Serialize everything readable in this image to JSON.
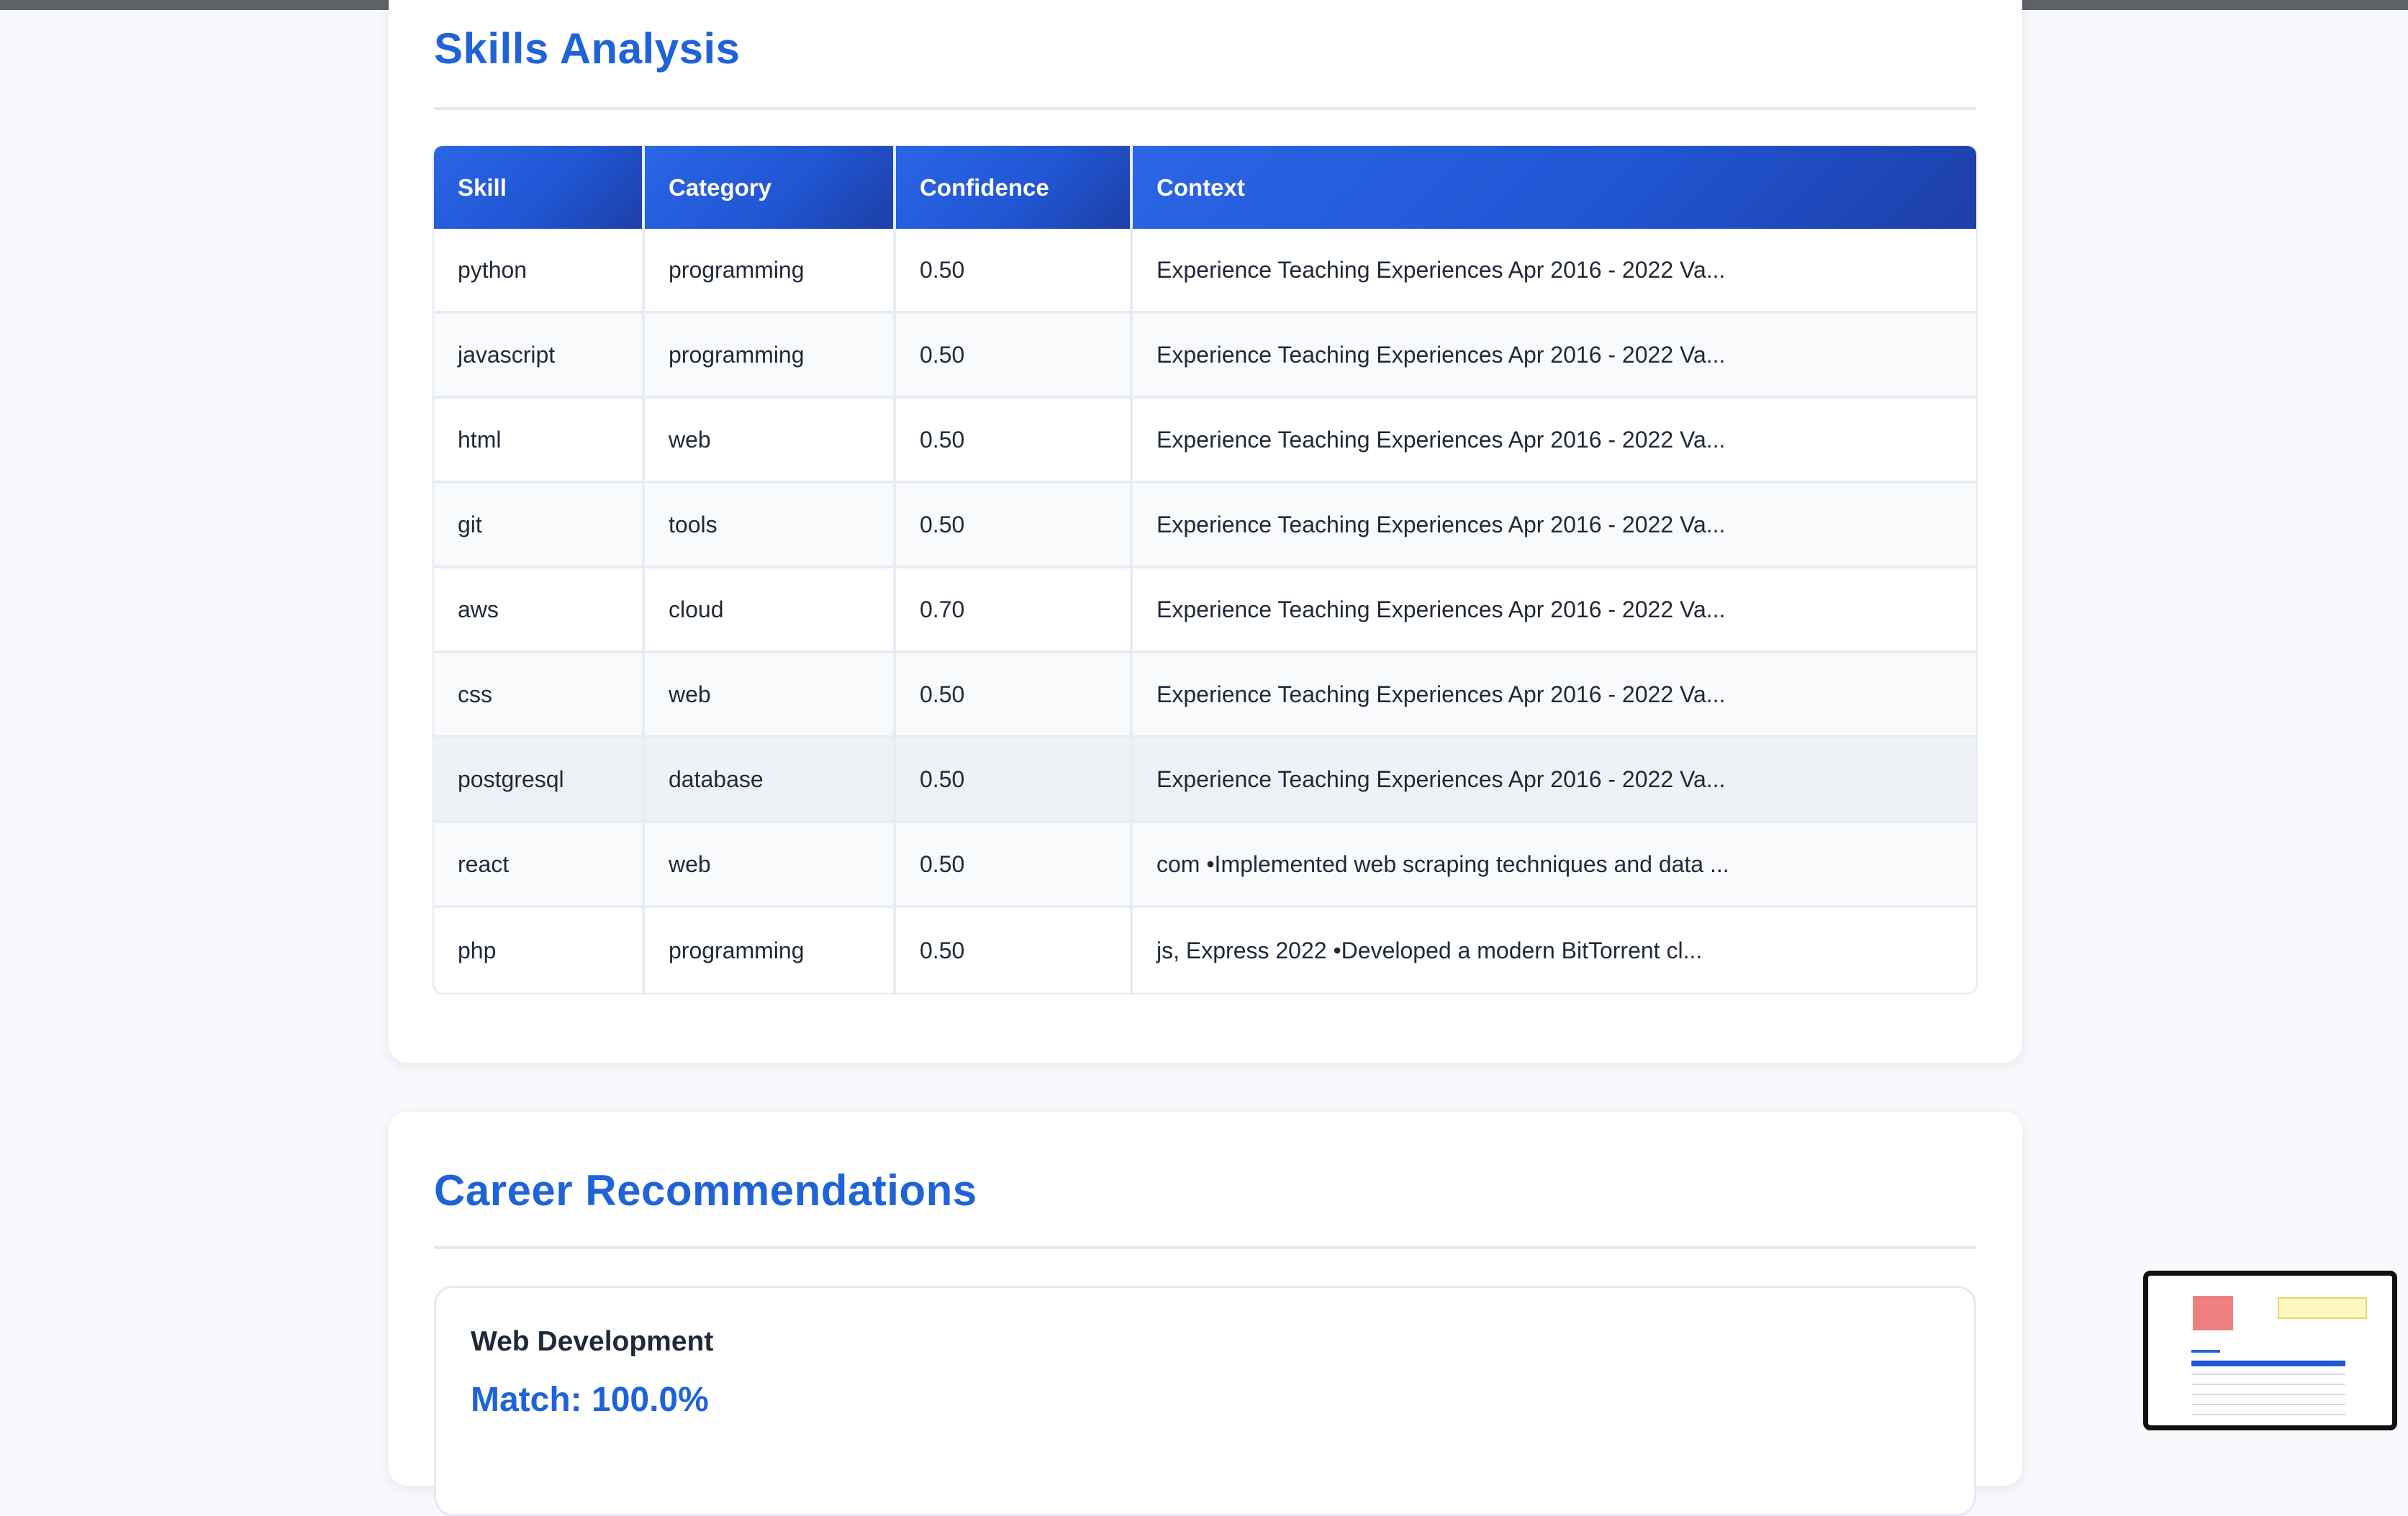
{
  "skills_section": {
    "title": "Skills Analysis",
    "columns": [
      "Skill",
      "Category",
      "Confidence",
      "Context"
    ],
    "rows": [
      {
        "skill": "python",
        "category": "programming",
        "confidence": "0.50",
        "context": "Experience Teaching Experiences Apr 2016 - 2022 Va..."
      },
      {
        "skill": "javascript",
        "category": "programming",
        "confidence": "0.50",
        "context": "Experience Teaching Experiences Apr 2016 - 2022 Va..."
      },
      {
        "skill": "html",
        "category": "web",
        "confidence": "0.50",
        "context": "Experience Teaching Experiences Apr 2016 - 2022 Va..."
      },
      {
        "skill": "git",
        "category": "tools",
        "confidence": "0.50",
        "context": "Experience Teaching Experiences Apr 2016 - 2022 Va..."
      },
      {
        "skill": "aws",
        "category": "cloud",
        "confidence": "0.70",
        "context": "Experience Teaching Experiences Apr 2016 - 2022 Va..."
      },
      {
        "skill": "css",
        "category": "web",
        "confidence": "0.50",
        "context": "Experience Teaching Experiences Apr 2016 - 2022 Va..."
      },
      {
        "skill": "postgresql",
        "category": "database",
        "confidence": "0.50",
        "context": "Experience Teaching Experiences Apr 2016 - 2022 Va..."
      },
      {
        "skill": "react",
        "category": "web",
        "confidence": "0.50",
        "context": "com •Implemented web scraping techniques and data ..."
      },
      {
        "skill": "php",
        "category": "programming",
        "confidence": "0.50",
        "context": "js, Express 2022 •Developed a modern BitTorrent cl..."
      }
    ]
  },
  "career_section": {
    "title": "Career Recommendations",
    "recommendations": [
      {
        "title": "Web Development",
        "match": "Match: 100.0%"
      }
    ]
  },
  "colors": {
    "accent": "#1f63d8",
    "header_gradient_start": "#2a66e6",
    "header_gradient_end": "#1d3fa8",
    "background": "#f7f9fc"
  }
}
